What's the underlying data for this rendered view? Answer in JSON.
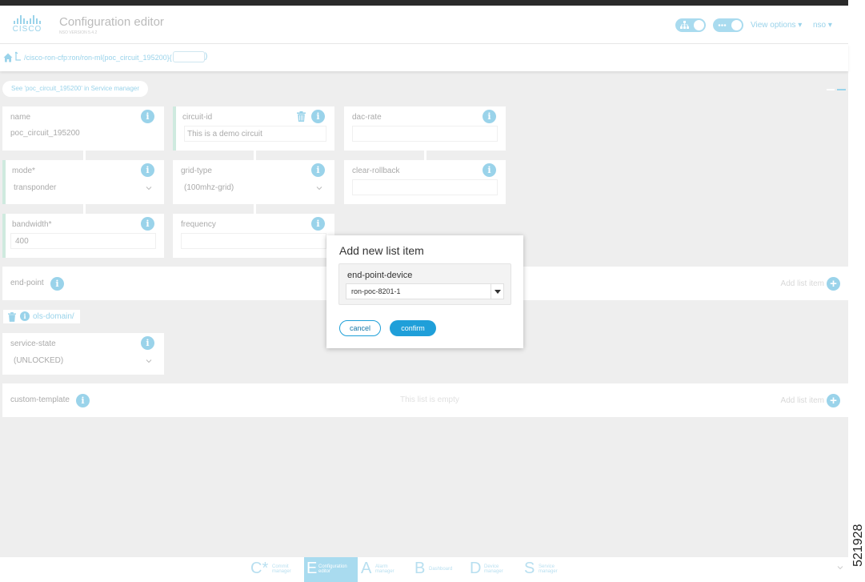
{
  "header": {
    "logo_text": "CISCO",
    "title": "Configuration editor",
    "version": "NSO VERSION 5.4.2",
    "view_options": "View options ▾",
    "user": "nso ▾"
  },
  "pathbar": {
    "path": "/cisco-ron-cfp:ron/ron-ml{poc_circuit_195200}{",
    "close": ")"
  },
  "service_link": "See 'poc_circuit_195200' in Service manager",
  "fields": {
    "name": {
      "label": "name",
      "value": "poc_circuit_195200"
    },
    "circuit_id": {
      "label": "circuit-id",
      "value": "This is a demo circuit"
    },
    "dac_rate": {
      "label": "dac-rate",
      "value": ""
    },
    "mode": {
      "label": "mode*",
      "value": "transponder"
    },
    "grid_type": {
      "label": "grid-type",
      "value": "(100mhz-grid)"
    },
    "clear_rollback": {
      "label": "clear-rollback",
      "value": ""
    },
    "bandwidth": {
      "label": "bandwidth*",
      "value": "400"
    },
    "frequency": {
      "label": "frequency",
      "value": ""
    }
  },
  "end_point": {
    "label": "end-point",
    "add": "Add list item"
  },
  "ols_domain": {
    "label": "ols-domain/"
  },
  "service_state": {
    "label": "service-state",
    "value": "(UNLOCKED)"
  },
  "custom_template": {
    "label": "custom-template",
    "empty": "This list is empty",
    "add": "Add list item"
  },
  "dialog": {
    "title": "Add new list item",
    "field_label": "end-point-device",
    "field_value": "ron-poc-8201-1",
    "cancel": "cancel",
    "confirm": "confirm"
  },
  "bottom_nav": [
    {
      "letter": "C*",
      "label": "Commit manager"
    },
    {
      "letter": "E",
      "label": "Configuration editor",
      "active": true
    },
    {
      "letter": "A",
      "label": "Alarm manager"
    },
    {
      "letter": "B",
      "label": "Dashboard"
    },
    {
      "letter": "D",
      "label": "Device manager"
    },
    {
      "letter": "S",
      "label": "Service manager"
    }
  ],
  "figure_id": "521928",
  "colors": {
    "accent": "#1f9fd9",
    "accent_light": "#9ad3ea",
    "background": "#eeeeee"
  }
}
